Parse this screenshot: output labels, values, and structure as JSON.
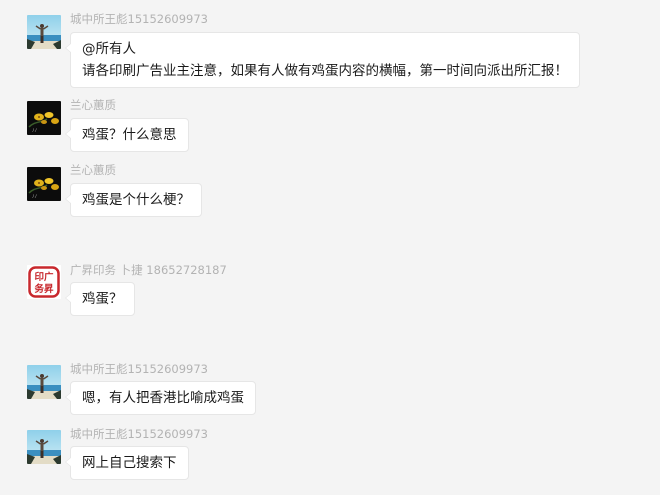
{
  "messages": [
    {
      "sender": "城中所王彪15152609973",
      "avatar": "beach-person-avatar",
      "lines": [
        "@所有人",
        "请各印刷广告业主注意，如果有人做有鸡蛋内容的横幅，第一时间向派出所汇报！"
      ]
    },
    {
      "sender": "兰心蕙质",
      "avatar": "yellow-flower-avatar",
      "lines": [
        "鸡蛋？什么意思"
      ]
    },
    {
      "sender": "兰心蕙质",
      "avatar": "yellow-flower-avatar",
      "lines": [
        "鸡蛋是个什么梗？"
      ]
    },
    {
      "sender": "广昇印务 卜捷 18652728187",
      "avatar": "print-shop-seal-avatar",
      "avatar_text": [
        "印广",
        "务昇"
      ],
      "lines": [
        "鸡蛋？"
      ]
    },
    {
      "sender": "城中所王彪15152609973",
      "avatar": "beach-person-avatar",
      "lines": [
        "嗯，有人把香港比喻成鸡蛋"
      ]
    },
    {
      "sender": "城中所王彪15152609973",
      "avatar": "beach-person-avatar",
      "lines": [
        "网上自己搜索下"
      ]
    }
  ],
  "colors": {
    "background": "#f4f4f4",
    "bubble": "#ffffff",
    "bubble_border": "#e6e6e6",
    "sender_text": "#b3b3b3",
    "message_text": "#1a1a1a",
    "seal_red": "#c8282d"
  }
}
